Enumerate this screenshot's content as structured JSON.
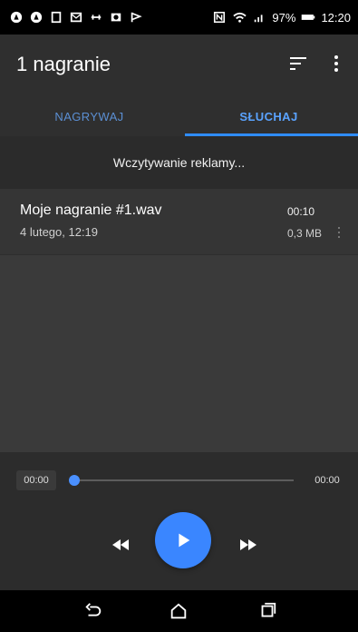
{
  "status_bar": {
    "battery": "97%",
    "time": "12:20",
    "icons": [
      "app-icon",
      "app-icon",
      "screen-icon",
      "mail-icon",
      "link-icon",
      "camera-icon",
      "flag-icon"
    ]
  },
  "app_bar": {
    "title": "1 nagranie"
  },
  "tabs": [
    {
      "label": "NAGRYWAJ",
      "selected": false
    },
    {
      "label": "SŁUCHAJ",
      "selected": true
    }
  ],
  "ad": {
    "text": "Wczytywanie reklamy..."
  },
  "recordings": [
    {
      "name": "Moje nagranie #1.wav",
      "date": "4 lutego, 12:19",
      "duration": "00:10",
      "size": "0,3 MB"
    }
  ],
  "player": {
    "current": "00:00",
    "total": "00:00",
    "progress": 0.0
  },
  "colors": {
    "accent": "#3a86ff"
  }
}
